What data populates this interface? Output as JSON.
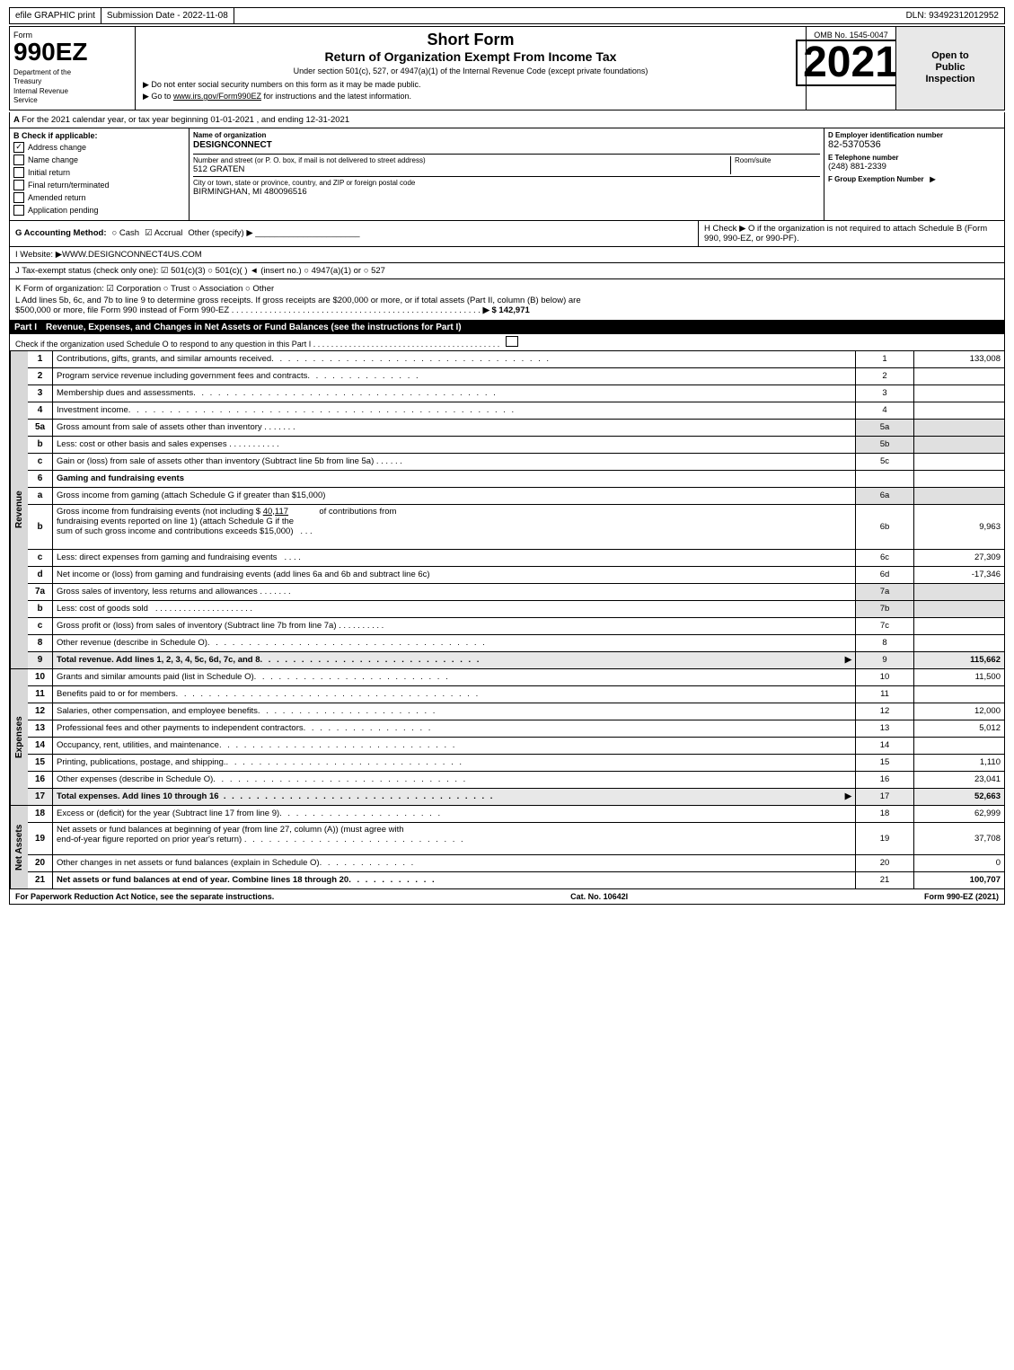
{
  "header": {
    "efile": "efile GRAPHIC print",
    "submission_date_label": "Submission Date - 2022-11-08",
    "dln_label": "DLN: 93492312012952",
    "form_label": "Form",
    "form_number": "990EZ",
    "dept_line1": "Department of the",
    "dept_line2": "Treasury",
    "dept_line3": "Internal Revenue",
    "dept_line4": "Service",
    "short_form": "Short Form",
    "return_title": "Return of Organization Exempt From Income Tax",
    "subtitle": "Under section 501(c), 527, or 4947(a)(1) of the Internal Revenue Code (except private foundations)",
    "instruction1": "▶ Do not enter social security numbers on this form as it may be made public.",
    "instruction2": "▶ Go to www.irs.gov/Form990EZ for instructions and the latest information.",
    "year": "2021",
    "omb_label": "OMB No. 1545-0047",
    "open_to_public": "Open to\nPublic\nInspection"
  },
  "section_a": {
    "label": "A",
    "text": "For the 2021 calendar year, or tax year beginning 01-01-2021 , and ending 12-31-2021"
  },
  "section_b": {
    "label": "B",
    "check_label": "Check if applicable:",
    "items": [
      {
        "label": "Address change",
        "checked": true
      },
      {
        "label": "Name change",
        "checked": false
      },
      {
        "label": "Initial return",
        "checked": false
      },
      {
        "label": "Final return/terminated",
        "checked": false
      },
      {
        "label": "Amended return",
        "checked": false
      },
      {
        "label": "Application pending",
        "checked": false
      }
    ]
  },
  "section_c": {
    "label": "C",
    "name_label": "Name of organization",
    "org_name": "DESIGNCONNECT",
    "address_label": "Number and street (or P. O. box, if mail is not delivered to street address)",
    "address_value": "512 GRATEN",
    "room_label": "Room/suite",
    "room_value": "",
    "city_label": "City or town, state or province, country, and ZIP or foreign postal code",
    "city_value": "BIRMINGHAN, MI  480096516"
  },
  "section_d": {
    "label": "D",
    "ein_label": "D Employer identification number",
    "ein_value": "82-5370536",
    "phone_label": "E Telephone number",
    "phone_value": "(248) 881-2339",
    "f_label": "F Group Exemption Number",
    "f_arrow": "▶"
  },
  "section_g": {
    "label": "G",
    "text": "G Accounting Method:",
    "cash_label": "Cash",
    "accrual_label": "Accrual",
    "accrual_checked": true,
    "other_label": "Other (specify) ▶",
    "underline": "______________________"
  },
  "section_h": {
    "text": "H  Check ▶  O if the organization is not required to attach Schedule B (Form 990, 990-EZ, or 990-PF)."
  },
  "section_i": {
    "label": "I",
    "text": "I Website: ▶WWW.DESIGNCONNECT4US.COM"
  },
  "section_j": {
    "label": "J",
    "text": "J Tax-exempt status (check only one): ☑ 501(c)(3) ○ 501(c)( ) ◄ (insert no.) ○ 4947(a)(1) or ○ 527"
  },
  "section_k": {
    "label": "K",
    "text": "K Form of organization: ☑ Corporation  ○ Trust  ○ Association  ○ Other"
  },
  "section_l": {
    "label": "L",
    "text1": "L Add lines 5b, 6c, and 7b to line 9 to determine gross receipts. If gross receipts are $200,000 or more, or if total assets (Part II, column (B) below) are",
    "text2": "$500,000 or more, file Form 990 instead of Form 990-EZ",
    "dots": ". . . . . . . . . . . . . . . . . . . . . . . . . . . . . . . . . . . . . . . . . . . . . . . . . . . . .",
    "amount": "▶ $ 142,971"
  },
  "part1": {
    "label": "Part I",
    "title": "Revenue, Expenses, and Changes in Net Assets or Fund Balances",
    "see_instructions": "(see the instructions for Part I)",
    "check_text": "Check if the organization used Schedule O to respond to any question in this Part I",
    "check_dots": ". . . . . . . . . . . . . . . . . . . . . . . . . . . . . . . . . . . . . . . . . .",
    "revenue_label": "Revenue",
    "lines": [
      {
        "num": "1",
        "desc": "Contributions, gifts, grants, and similar amounts received",
        "dots": true,
        "lineref": "1",
        "amount": "133,008"
      },
      {
        "num": "2",
        "desc": "Program service revenue including government fees and contracts",
        "dots": true,
        "lineref": "2",
        "amount": ""
      },
      {
        "num": "3",
        "desc": "Membership dues and assessments",
        "dots": true,
        "lineref": "3",
        "amount": ""
      },
      {
        "num": "4",
        "desc": "Investment income",
        "dots": true,
        "lineref": "4",
        "amount": ""
      },
      {
        "num": "5a",
        "desc": "Gross amount from sale of assets other than inventory . . . . . . .",
        "dots": false,
        "lineref": "5a",
        "amount": "",
        "shaded": true
      },
      {
        "num": "b",
        "desc": "Less: cost or other basis and sales expenses . . . . . . . . . . .",
        "dots": false,
        "lineref": "5b",
        "amount": "",
        "shaded": true
      },
      {
        "num": "c",
        "desc": "Gain or (loss) from sale of assets other than inventory (Subtract line 5b from line 5a) . . . . . .",
        "dots": false,
        "lineref": "5c",
        "amount": ""
      },
      {
        "num": "6",
        "desc": "Gaming and fundraising events",
        "dots": false,
        "lineref": "",
        "amount": "",
        "header": true
      },
      {
        "num": "a",
        "desc": "Gross income from gaming (attach Schedule G if greater than $15,000)",
        "dots": false,
        "lineref": "6a",
        "amount": "",
        "shaded": true
      },
      {
        "num": "b",
        "desc_part1": "Gross income from fundraising events (not including $",
        "fundraising_amt": "40,117",
        "desc_part2": " of contributions from fundraising events reported on line 1) (attach Schedule G if the sum of such gross income and contributions exceeds $15,000) . . .",
        "lineref": "6b",
        "amount": "9,963",
        "multiline": true
      },
      {
        "num": "c",
        "desc": "Less: direct expenses from gaming and fundraising events . . . .",
        "dots": false,
        "lineref": "6c",
        "amount": "27,309"
      },
      {
        "num": "d",
        "desc": "Net income or (loss) from gaming and fundraising events (add lines 6a and 6b and subtract line 6c)",
        "dots": false,
        "lineref": "6d",
        "amount": "-17,346"
      },
      {
        "num": "7a",
        "desc": "Gross sales of inventory, less returns and allowances . . . . . . .",
        "dots": false,
        "lineref": "7a",
        "amount": "",
        "shaded": true
      },
      {
        "num": "b",
        "desc": "Less: cost of goods sold . . . . . . . . . . . . . . . . . . . . .",
        "dots": false,
        "lineref": "7b",
        "amount": "",
        "shaded": true
      },
      {
        "num": "c",
        "desc": "Gross profit or (loss) from sales of inventory (Subtract line 7b from line 7a) . . . . . . . . . .",
        "dots": false,
        "lineref": "7c",
        "amount": ""
      },
      {
        "num": "8",
        "desc": "Other revenue (describe in Schedule O)",
        "dots": true,
        "lineref": "8",
        "amount": ""
      },
      {
        "num": "9",
        "desc": "Total revenue. Add lines 1, 2, 3, 4, 5c, 6d, 7c, and 8",
        "dots": true,
        "lineref": "9",
        "amount": "115,662",
        "bold": true,
        "arrow": "▶"
      }
    ]
  },
  "expenses_section": {
    "label": "Expenses",
    "lines": [
      {
        "num": "10",
        "desc": "Grants and similar amounts paid (list in Schedule O)",
        "dots": true,
        "lineref": "10",
        "amount": "11,500"
      },
      {
        "num": "11",
        "desc": "Benefits paid to or for members",
        "dots": true,
        "lineref": "11",
        "amount": ""
      },
      {
        "num": "12",
        "desc": "Salaries, other compensation, and employee benefits",
        "dots": true,
        "lineref": "12",
        "amount": "12,000"
      },
      {
        "num": "13",
        "desc": "Professional fees and other payments to independent contractors",
        "dots": true,
        "lineref": "13",
        "amount": "5,012"
      },
      {
        "num": "14",
        "desc": "Occupancy, rent, utilities, and maintenance",
        "dots": true,
        "lineref": "14",
        "amount": ""
      },
      {
        "num": "15",
        "desc": "Printing, publications, postage, and shipping.",
        "dots": true,
        "lineref": "15",
        "amount": "1,110"
      },
      {
        "num": "16",
        "desc": "Other expenses (describe in Schedule O)",
        "dots": true,
        "lineref": "16",
        "amount": "23,041"
      },
      {
        "num": "17",
        "desc": "Total expenses. Add lines 10 through 16",
        "dots": true,
        "lineref": "17",
        "amount": "52,663",
        "bold": true,
        "arrow": "▶"
      }
    ]
  },
  "net_assets_section": {
    "label": "Net Assets",
    "lines": [
      {
        "num": "18",
        "desc": "Excess or (deficit) for the year (Subtract line 17 from line 9)",
        "dots": true,
        "lineref": "18",
        "amount": "62,999"
      },
      {
        "num": "19",
        "desc": "Net assets or fund balances at beginning of year (from line 27, column (A)) (must agree with end-of-year figure reported on prior year's return)",
        "dots": true,
        "lineref": "19",
        "amount": "37,708",
        "multiline": true
      },
      {
        "num": "20",
        "desc": "Other changes in net assets or fund balances (explain in Schedule O)",
        "dots": true,
        "lineref": "20",
        "amount": "0"
      },
      {
        "num": "21",
        "desc": "Net assets or fund balances at end of year. Combine lines 18 through 20",
        "dots": true,
        "lineref": "21",
        "amount": "100,707",
        "bold": true
      }
    ]
  },
  "footer": {
    "paperwork_text": "For Paperwork Reduction Act Notice, see the separate instructions.",
    "cat_label": "Cat. No. 10642I",
    "form_label": "Form 990-EZ (2021)"
  }
}
